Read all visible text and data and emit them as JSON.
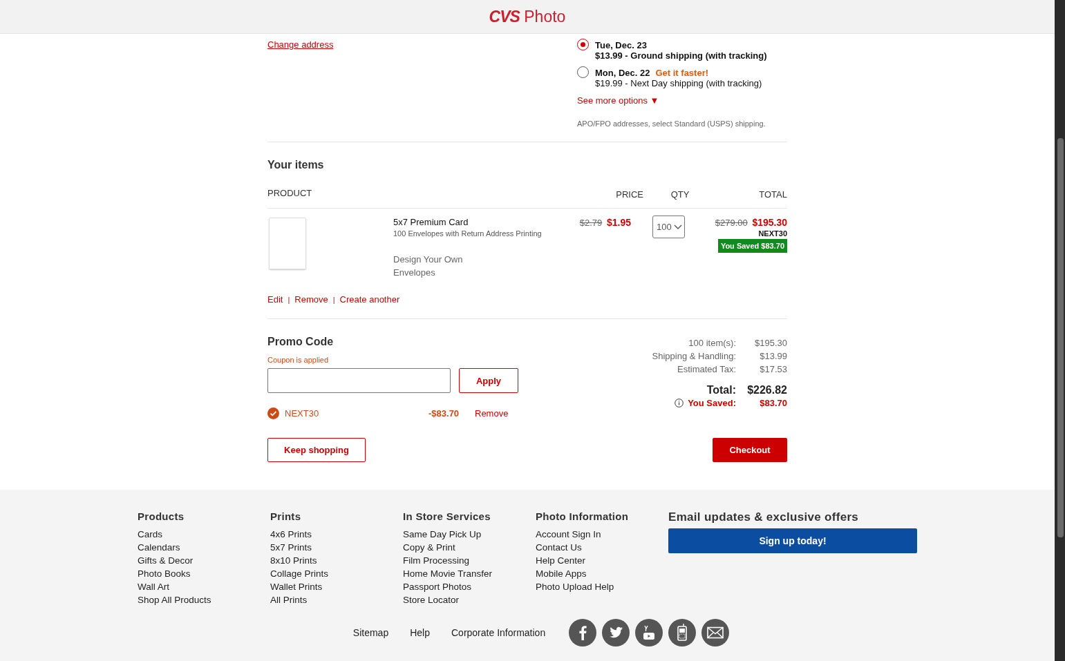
{
  "header": {
    "brand": "CVS",
    "product": "Photo"
  },
  "shipping": {
    "change_address": "Change address",
    "options": [
      {
        "date": "Tue, Dec. 23",
        "detail": "$13.99 - Ground shipping (with tracking)",
        "selected": true
      },
      {
        "date": "Mon, Dec. 22",
        "tag": "Get it faster!",
        "detail": "$19.99 - Next Day shipping (with tracking)",
        "selected": false
      }
    ],
    "see_more": "See more options",
    "see_more_arrow": "▼",
    "note": "APO/FPO addresses, select Standard (USPS) shipping."
  },
  "items": {
    "heading": "Your items",
    "columns": [
      "PRODUCT",
      "PRICE",
      "QTY",
      "TOTAL"
    ],
    "rows": [
      {
        "name": "5x7 Premium Card",
        "description": "100 Envelopes with Return Address Printing",
        "option": "Design Your Own Envelopes",
        "old_price": "$2.79",
        "price": "$1.95",
        "qty": "100",
        "old_total": "$279.00",
        "total": "$195.30",
        "code": "NEXT30",
        "saved": "You Saved $83.70",
        "actions": [
          "Edit",
          "Remove",
          "Create another"
        ],
        "action_separator": "|"
      }
    ]
  },
  "promo": {
    "heading": "Promo Code",
    "status": "Coupon is applied",
    "apply": "Apply",
    "coupons": [
      {
        "code": "NEXT30",
        "amount": "-$83.70",
        "remove": "Remove"
      }
    ]
  },
  "summary": {
    "lines": [
      {
        "label": "100 item(s):",
        "value": "$195.30"
      },
      {
        "label": "Shipping & Handling:",
        "value": "$13.99"
      },
      {
        "label": "Estimated Tax:",
        "value": "$17.53"
      }
    ],
    "total_label": "Total:",
    "total": "$226.82",
    "saved_label": "You Saved:",
    "saved": "$83.70"
  },
  "buttons": {
    "keep_shopping": "Keep shopping",
    "checkout": "Checkout"
  },
  "footer": {
    "columns": [
      {
        "heading": "Products",
        "links": [
          "Cards",
          "Calendars",
          "Gifts & Decor",
          "Photo Books",
          "Wall Art",
          "Shop All Products"
        ]
      },
      {
        "heading": "Prints",
        "links": [
          "4x6 Prints",
          "5x7 Prints",
          "8x10 Prints",
          "Collage Prints",
          "Wallet Prints",
          "All Prints"
        ]
      },
      {
        "heading": "In Store Services",
        "links": [
          "Same Day Pick Up",
          "Copy & Print",
          "Film Processing",
          "Home Movie Transfer",
          "Passport Photos",
          "Store Locator"
        ]
      },
      {
        "heading": "Photo Information",
        "links": [
          "Account Sign In",
          "Contact Us",
          "Help Center",
          "Mobile Apps",
          "Photo Upload Help"
        ]
      }
    ],
    "email": {
      "heading": "Email updates & exclusive offers",
      "button": "Sign up today!"
    },
    "bottom_links": [
      "Sitemap",
      "Help",
      "Corporate Information"
    ],
    "social": [
      {
        "kind": "facebook"
      },
      {
        "kind": "twitter"
      },
      {
        "kind": "video"
      },
      {
        "kind": "mobile"
      },
      {
        "kind": "email"
      }
    ]
  }
}
